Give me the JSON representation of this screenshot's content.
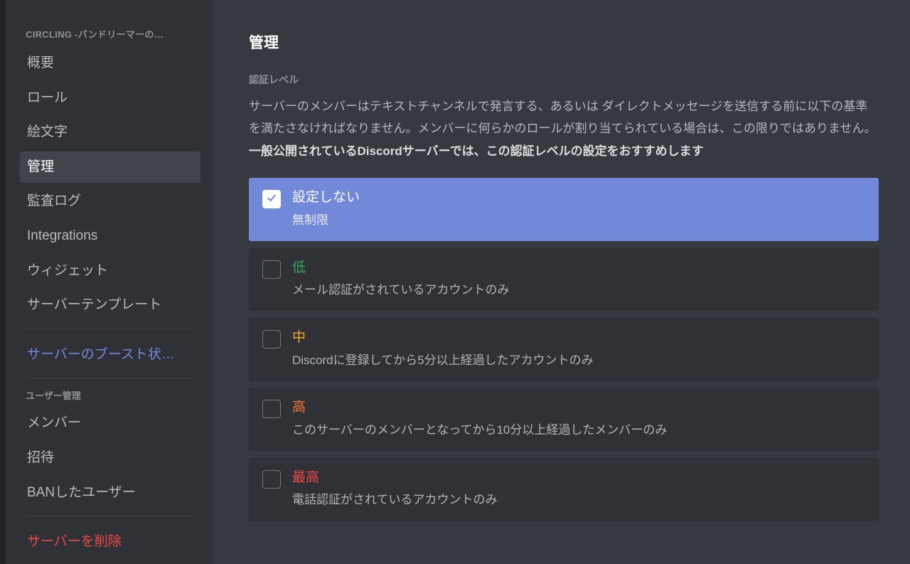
{
  "sidebar": {
    "server_name": "CIRCLING -バンドリーマーの…",
    "items": [
      {
        "label": "概要"
      },
      {
        "label": "ロール"
      },
      {
        "label": "絵文字"
      },
      {
        "label": "管理",
        "active": true
      },
      {
        "label": "監査ログ"
      },
      {
        "label": "Integrations"
      },
      {
        "label": "ウィジェット"
      },
      {
        "label": "サーバーテンプレート"
      }
    ],
    "boost_label": "サーバーのブースト状…",
    "user_mgmt_header": "ユーザー管理",
    "user_items": [
      {
        "label": "メンバー"
      },
      {
        "label": "招待"
      },
      {
        "label": "BANしたユーザー"
      }
    ],
    "delete_label": "サーバーを削除"
  },
  "page": {
    "title": "管理",
    "verification": {
      "label": "認証レベル",
      "desc_plain": "サーバーのメンバーはテキストチャンネルで発言する、あるいは ダイレクトメッセージを送信する前に以下の基準を満たさなければなりません。メンバーに何らかのロールが割り当てられている場合は、この限りではありません。 ",
      "desc_bold": "一般公開されているDiscordサーバーでは、この認証レベルの設定をおすすめします",
      "options": [
        {
          "title": "設定しない",
          "sub": "無制限",
          "selected": true,
          "level": "none"
        },
        {
          "title": "低",
          "sub": "メール認証がされているアカウントのみ",
          "level": "low"
        },
        {
          "title": "中",
          "sub": "Discordに登録してから5分以上経過したアカウントのみ",
          "level": "medium"
        },
        {
          "title": "高",
          "sub": "このサーバーのメンバーとなってから10分以上経過したメンバーのみ",
          "level": "high"
        },
        {
          "title": "最高",
          "sub": "電話認証がされているアカウントのみ",
          "level": "highest"
        }
      ]
    }
  }
}
